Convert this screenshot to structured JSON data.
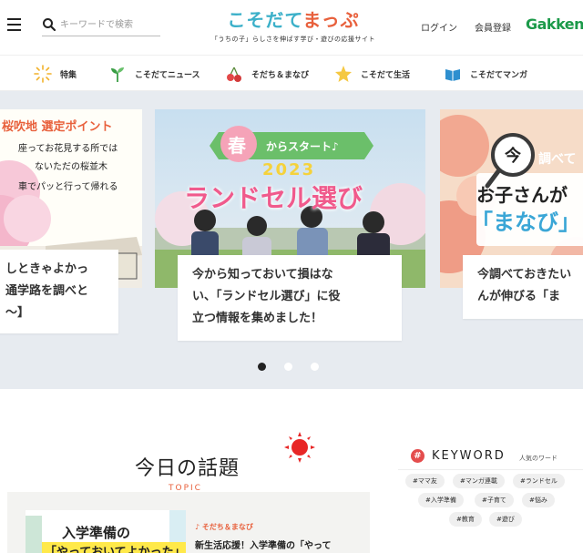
{
  "header": {
    "search_placeholder": "キーワードで検索",
    "logo_part1": "こそだて",
    "logo_part2": "まっぷ",
    "tagline": "「うちの子」らしさを伸ばす学び・遊びの応援サイト",
    "login": "ログイン",
    "register": "会員登録",
    "brand": "Gakken"
  },
  "nav": {
    "items": [
      {
        "label": "特集",
        "icon": "sparkle-icon"
      },
      {
        "label": "こそだてニュース",
        "icon": "sprout-icon"
      },
      {
        "label": "そだち＆まなび",
        "icon": "cherry-icon"
      },
      {
        "label": "こそだて生活",
        "icon": "star-icon"
      },
      {
        "label": "こそだてマンガ",
        "icon": "book-icon"
      }
    ]
  },
  "carousel": {
    "slides": [
      {
        "image_text_1": "桜吹地 選定ポイント",
        "image_text_2": "座ってお花見する所では",
        "image_text_3": "ないただの桜並木",
        "image_text_4": "車でパッと行って帰れる",
        "caption_line1": "しときゃよかっ",
        "caption_line2": "通学路を調べと",
        "caption_line3": "〜】"
      },
      {
        "banner_word": "春",
        "banner_rest": "からスタート♪",
        "year": "2023",
        "headline": "ランドセル選び",
        "caption_line1": "今から知っておいて損はな",
        "caption_line2": "い、「ランドセル選び」に役",
        "caption_line3": "立つ情報を集めました！"
      },
      {
        "circle_char": "今",
        "side_text": "調べて",
        "line1": "お子さんが",
        "line2": "「まなび」",
        "caption_line1": "今調べておきたい",
        "caption_line2": "んが伸びる「ま"
      }
    ],
    "active_index": 0
  },
  "topic": {
    "title": "今日の話題",
    "sub": "TOPIC",
    "card": {
      "thumb_line1": "入学準備の",
      "thumb_line2": "「やっておいてよかった」",
      "category": "そだち＆まなび",
      "title": "新生活応援！入学準備の「やって"
    }
  },
  "keyword": {
    "title": "KEYWORD",
    "sub": "人気のワード",
    "tags": [
      "#ママ友",
      "#マンガ連載",
      "#ランドセル",
      "#入学準備",
      "#子育て",
      "#悩み",
      "#教育",
      "#遊び"
    ]
  },
  "colors": {
    "accent_orange": "#e8603c",
    "logo_blue": "#3bb0c9",
    "brand_green": "#1c9a4a",
    "carousel_bg": "#e7ebf0"
  }
}
